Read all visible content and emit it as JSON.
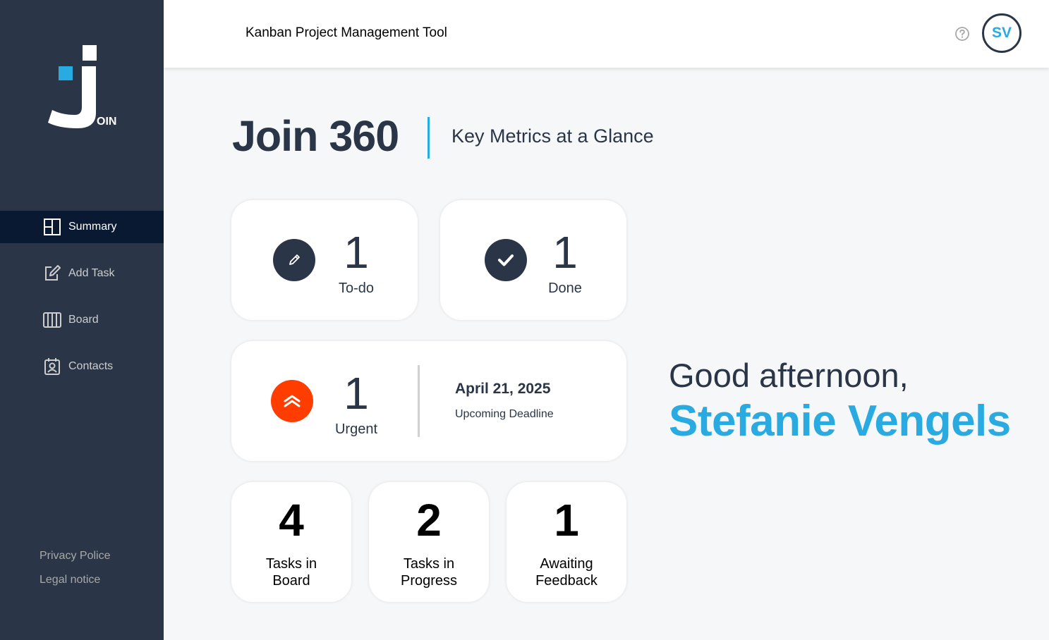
{
  "app": {
    "header_title": "Kanban Project Management Tool",
    "avatar_initials": "SV",
    "logo_text": "OIN",
    "accent_color": "#29abe2",
    "sidebar_color": "#2a3647",
    "urgent_color": "#ff3d00"
  },
  "sidebar": {
    "items": [
      {
        "label": "Summary",
        "icon": "summary-icon",
        "active": true
      },
      {
        "label": "Add Task",
        "icon": "edit-square-icon",
        "active": false
      },
      {
        "label": "Board",
        "icon": "board-columns-icon",
        "active": false
      },
      {
        "label": "Contacts",
        "icon": "contact-badge-icon",
        "active": false
      }
    ],
    "footer_links": [
      "Privacy Police",
      "Legal notice"
    ]
  },
  "page": {
    "title": "Join 360",
    "subtitle": "Key Metrics at a Glance"
  },
  "metrics": {
    "todo": {
      "count": "1",
      "label": "To-do",
      "icon": "pencil-icon"
    },
    "done": {
      "count": "1",
      "label": "Done",
      "icon": "check-icon"
    },
    "urgent": {
      "count": "1",
      "label": "Urgent",
      "icon": "double-chevron-up-icon"
    },
    "deadline": {
      "date": "April 21, 2025",
      "label": "Upcoming Deadline"
    },
    "tasks_in_board": {
      "count": "4",
      "label": "Tasks in Board"
    },
    "tasks_in_progress": {
      "count": "2",
      "label": "Tasks in Progress"
    },
    "awaiting_feedback": {
      "count": "1",
      "label": "Awaiting Feedback"
    }
  },
  "greeting": {
    "text": "Good afternoon,",
    "name": "Stefanie Vengels"
  }
}
